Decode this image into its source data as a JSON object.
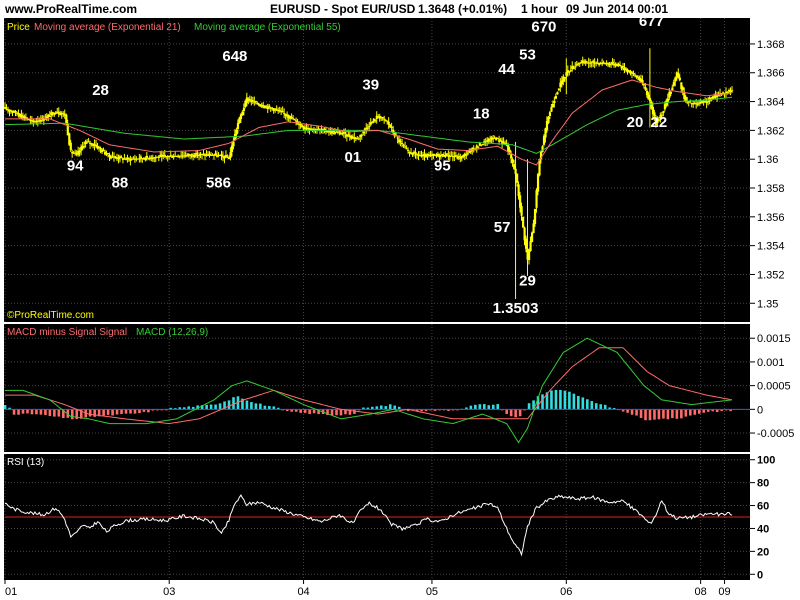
{
  "header": {
    "site": "www.ProRealTime.com",
    "instrument": "EURUSD - Spot EUR/USD",
    "price": "1.3648 (+0.01%)",
    "interval": "1 hour",
    "datetime": "09 Jun 2014 00:01"
  },
  "copyright": "©ProRealTime.com",
  "colors": {
    "background": "#000000",
    "price": "#ffff00",
    "ema21": "#ff6b6b",
    "ema55": "#33cc33",
    "macd_line": "#33cc33",
    "signal_line": "#ff6b6b",
    "hist_pos": "#33dddd",
    "hist_neg": "#ff6b6b",
    "rsi_line": "#ffffff",
    "rsi_level": "#dd2222",
    "grid": "#444444",
    "annotation": "#ffffff"
  },
  "chart_data": [
    {
      "type": "candlestick",
      "legend": {
        "price": "Price",
        "ema21": "Moving average (Exponential 21)",
        "ema55": "Moving average (Exponential 55)"
      },
      "x_ticks": [
        "01",
        "03",
        "04",
        "05",
        "06",
        "08",
        "09"
      ],
      "y_ticks": [
        "1.368",
        "1.366",
        "1.364",
        "1.362",
        "1.36",
        "1.358",
        "1.356",
        "1.354",
        "1.352",
        "1.35"
      ],
      "y_tick_values": [
        1.368,
        1.366,
        1.364,
        1.362,
        1.36,
        1.358,
        1.356,
        1.354,
        1.352,
        1.35
      ],
      "ylim": [
        1.3487,
        1.3698
      ],
      "grid": true,
      "price_waypoints": [
        [
          0,
          1.3635
        ],
        [
          8,
          1.3632
        ],
        [
          18,
          1.3626
        ],
        [
          26,
          1.3628
        ],
        [
          34,
          1.3633
        ],
        [
          40,
          1.3631
        ],
        [
          44,
          1.3605
        ],
        [
          48,
          1.3603
        ],
        [
          54,
          1.3612
        ],
        [
          60,
          1.361
        ],
        [
          70,
          1.3602
        ],
        [
          82,
          1.36
        ],
        [
          95,
          1.3601
        ],
        [
          108,
          1.3602
        ],
        [
          125,
          1.3603
        ],
        [
          140,
          1.3603
        ],
        [
          150,
          1.3601
        ],
        [
          156,
          1.3625
        ],
        [
          162,
          1.3642
        ],
        [
          170,
          1.3638
        ],
        [
          180,
          1.3635
        ],
        [
          190,
          1.363
        ],
        [
          200,
          1.3622
        ],
        [
          212,
          1.362
        ],
        [
          226,
          1.3618
        ],
        [
          236,
          1.3614
        ],
        [
          242,
          1.3622
        ],
        [
          250,
          1.363
        ],
        [
          256,
          1.3626
        ],
        [
          262,
          1.3615
        ],
        [
          270,
          1.3605
        ],
        [
          280,
          1.3602
        ],
        [
          295,
          1.3603
        ],
        [
          305,
          1.3601
        ],
        [
          318,
          1.361
        ],
        [
          328,
          1.3615
        ],
        [
          336,
          1.361
        ],
        [
          342,
          1.359
        ],
        [
          346,
          1.356
        ],
        [
          350,
          1.353
        ],
        [
          354,
          1.3555
        ],
        [
          358,
          1.36
        ],
        [
          364,
          1.363
        ],
        [
          370,
          1.3648
        ],
        [
          376,
          1.366
        ],
        [
          384,
          1.3667
        ],
        [
          396,
          1.3667
        ],
        [
          410,
          1.3666
        ],
        [
          418,
          1.3661
        ],
        [
          426,
          1.3655
        ],
        [
          432,
          1.364
        ],
        [
          436,
          1.3625
        ],
        [
          440,
          1.3632
        ],
        [
          446,
          1.3648
        ],
        [
          450,
          1.366
        ],
        [
          456,
          1.364
        ],
        [
          462,
          1.3638
        ],
        [
          470,
          1.364
        ],
        [
          478,
          1.3645
        ],
        [
          487,
          1.3648
        ]
      ],
      "ema21_waypoints": [
        [
          0,
          1.3628
        ],
        [
          30,
          1.3628
        ],
        [
          50,
          1.362
        ],
        [
          70,
          1.361
        ],
        [
          100,
          1.3605
        ],
        [
          130,
          1.3606
        ],
        [
          150,
          1.3611
        ],
        [
          170,
          1.3622
        ],
        [
          190,
          1.3626
        ],
        [
          210,
          1.3623
        ],
        [
          230,
          1.3619
        ],
        [
          250,
          1.362
        ],
        [
          270,
          1.3614
        ],
        [
          290,
          1.3607
        ],
        [
          310,
          1.3606
        ],
        [
          330,
          1.3609
        ],
        [
          346,
          1.36
        ],
        [
          356,
          1.3596
        ],
        [
          366,
          1.3612
        ],
        [
          380,
          1.3632
        ],
        [
          400,
          1.3648
        ],
        [
          420,
          1.3655
        ],
        [
          436,
          1.365
        ],
        [
          450,
          1.3647
        ],
        [
          470,
          1.3644
        ],
        [
          487,
          1.3646
        ]
      ],
      "ema55_waypoints": [
        [
          0,
          1.3624
        ],
        [
          40,
          1.3625
        ],
        [
          80,
          1.3618
        ],
        [
          120,
          1.3614
        ],
        [
          160,
          1.3616
        ],
        [
          190,
          1.362
        ],
        [
          220,
          1.362
        ],
        [
          250,
          1.362
        ],
        [
          280,
          1.3616
        ],
        [
          310,
          1.3612
        ],
        [
          340,
          1.361
        ],
        [
          356,
          1.3604
        ],
        [
          370,
          1.3612
        ],
        [
          390,
          1.3624
        ],
        [
          410,
          1.3634
        ],
        [
          430,
          1.3638
        ],
        [
          450,
          1.364
        ],
        [
          470,
          1.3641
        ],
        [
          487,
          1.3643
        ]
      ],
      "annotations": [
        {
          "text": "28",
          "x": 64,
          "y": 1.36445
        },
        {
          "text": "94",
          "x": 47,
          "y": 1.35923
        },
        {
          "text": "88",
          "x": 77,
          "y": 1.35803
        },
        {
          "text": "648",
          "x": 154,
          "y": 1.36683
        },
        {
          "text": "586",
          "x": 143,
          "y": 1.35803
        },
        {
          "text": "39",
          "x": 245,
          "y": 1.36482
        },
        {
          "text": "01",
          "x": 233,
          "y": 1.35982
        },
        {
          "text": "18",
          "x": 319,
          "y": 1.36283
        },
        {
          "text": "95",
          "x": 293,
          "y": 1.35923
        },
        {
          "text": "44",
          "x": 336,
          "y": 1.36591
        },
        {
          "text": "53",
          "x": 350,
          "y": 1.36693
        },
        {
          "text": "670",
          "x": 361,
          "y": 1.36888
        },
        {
          "text": "677",
          "x": 433,
          "y": 1.36923
        },
        {
          "text": "20",
          "x": 422,
          "y": 1.36223
        },
        {
          "text": "22",
          "x": 438,
          "y": 1.36223
        },
        {
          "text": "57",
          "x": 333,
          "y": 1.35493
        },
        {
          "text": "29",
          "x": 350,
          "y": 1.35122
        },
        {
          "text": "1.3503",
          "x": 342,
          "y": 1.34931
        }
      ]
    },
    {
      "type": "bar",
      "legend": {
        "hist": "MACD minus Signal Signal",
        "macd": "MACD (12,26,9)"
      },
      "y_ticks": [
        "0.0015",
        "0.001",
        "0.0005",
        "0",
        "-0.0005"
      ],
      "y_tick_values": [
        0.0015,
        0.001,
        0.0005,
        0,
        -0.0005
      ],
      "ylim": [
        -0.0009,
        0.0018
      ],
      "histogram_waypoints": [
        [
          0,
          9e-05
        ],
        [
          5,
          2e-05
        ],
        [
          6,
          -0.0001
        ],
        [
          20,
          -0.0001
        ],
        [
          44,
          -0.0002
        ],
        [
          50,
          -0.0002
        ],
        [
          60,
          -0.00015
        ],
        [
          90,
          -8e-05
        ],
        [
          110,
          2e-05
        ],
        [
          140,
          0.0001
        ],
        [
          150,
          0.0002
        ],
        [
          155,
          0.0003
        ],
        [
          165,
          0.00015
        ],
        [
          180,
          5e-05
        ],
        [
          190,
          -5e-05
        ],
        [
          200,
          -8e-05
        ],
        [
          220,
          -0.00012
        ],
        [
          234,
          -0.0001
        ],
        [
          240,
          3e-05
        ],
        [
          260,
          0.0001
        ],
        [
          270,
          -3e-05
        ],
        [
          300,
          -2e-05
        ],
        [
          316,
          0.0001
        ],
        [
          330,
          0.0001
        ],
        [
          336,
          -0.0001
        ],
        [
          344,
          -0.0002
        ],
        [
          350,
          0.0001
        ],
        [
          358,
          0.0003
        ],
        [
          366,
          0.0004
        ],
        [
          375,
          0.0004
        ],
        [
          390,
          0.0002
        ],
        [
          410,
          0.0
        ],
        [
          420,
          -0.0001
        ],
        [
          430,
          -0.00025
        ],
        [
          436,
          -0.0002
        ],
        [
          450,
          -0.0002
        ],
        [
          470,
          -5e-05
        ],
        [
          487,
          -3e-05
        ]
      ],
      "macd_waypoints": [
        [
          0,
          0.0004
        ],
        [
          12,
          0.0004
        ],
        [
          30,
          0.0002
        ],
        [
          44,
          -0.00015
        ],
        [
          56,
          -0.0002
        ],
        [
          70,
          -0.0003
        ],
        [
          95,
          -0.0003
        ],
        [
          115,
          -0.0002
        ],
        [
          140,
          0.0002
        ],
        [
          152,
          0.0005
        ],
        [
          162,
          0.0006
        ],
        [
          180,
          0.0004
        ],
        [
          200,
          0.0001
        ],
        [
          225,
          -0.0002
        ],
        [
          245,
          -0.0001
        ],
        [
          260,
          0.0
        ],
        [
          280,
          -0.0002
        ],
        [
          300,
          -0.0003
        ],
        [
          320,
          -0.0001
        ],
        [
          336,
          -0.0003
        ],
        [
          344,
          -0.0007
        ],
        [
          350,
          -0.0004
        ],
        [
          360,
          0.0005
        ],
        [
          374,
          0.0012
        ],
        [
          390,
          0.0015
        ],
        [
          410,
          0.0012
        ],
        [
          428,
          0.0005
        ],
        [
          440,
          0.0002
        ],
        [
          460,
          0.0001
        ],
        [
          487,
          0.0002
        ]
      ],
      "signal_waypoints": [
        [
          0,
          0.0003
        ],
        [
          20,
          0.0003
        ],
        [
          40,
          0.0001
        ],
        [
          56,
          -0.0001
        ],
        [
          80,
          -0.0002
        ],
        [
          110,
          -0.0003
        ],
        [
          130,
          -0.0002
        ],
        [
          160,
          0.0002
        ],
        [
          180,
          0.0004
        ],
        [
          200,
          0.0002
        ],
        [
          225,
          0.0
        ],
        [
          250,
          -0.0001
        ],
        [
          270,
          0.0
        ],
        [
          300,
          -0.0002
        ],
        [
          330,
          -0.0002
        ],
        [
          350,
          -0.0002
        ],
        [
          365,
          0.0004
        ],
        [
          380,
          0.0009
        ],
        [
          398,
          0.0013
        ],
        [
          414,
          0.0013
        ],
        [
          430,
          0.0008
        ],
        [
          445,
          0.0005
        ],
        [
          470,
          0.0003
        ],
        [
          487,
          0.0002
        ]
      ]
    },
    {
      "type": "line",
      "legend": {
        "rsi": "RSI (13)"
      },
      "y_ticks": [
        "100",
        "80",
        "60",
        "40",
        "20",
        "0"
      ],
      "y_tick_values": [
        100,
        80,
        60,
        40,
        20,
        0
      ],
      "ylim": [
        -5,
        105
      ],
      "level": 50,
      "rsi_waypoints": [
        [
          0,
          62
        ],
        [
          6,
          57
        ],
        [
          12,
          55
        ],
        [
          20,
          53
        ],
        [
          26,
          52
        ],
        [
          34,
          58
        ],
        [
          38,
          52
        ],
        [
          40,
          48
        ],
        [
          44,
          33
        ],
        [
          48,
          36
        ],
        [
          52,
          43
        ],
        [
          56,
          40
        ],
        [
          62,
          46
        ],
        [
          68,
          37
        ],
        [
          74,
          43
        ],
        [
          82,
          47
        ],
        [
          95,
          48
        ],
        [
          108,
          47
        ],
        [
          120,
          51
        ],
        [
          132,
          48
        ],
        [
          140,
          45
        ],
        [
          145,
          35
        ],
        [
          150,
          47
        ],
        [
          154,
          62
        ],
        [
          158,
          68
        ],
        [
          162,
          61
        ],
        [
          170,
          63
        ],
        [
          180,
          58
        ],
        [
          190,
          54
        ],
        [
          200,
          50
        ],
        [
          212,
          46
        ],
        [
          224,
          52
        ],
        [
          233,
          44
        ],
        [
          238,
          55
        ],
        [
          244,
          62
        ],
        [
          252,
          56
        ],
        [
          258,
          44
        ],
        [
          266,
          40
        ],
        [
          274,
          42
        ],
        [
          282,
          48
        ],
        [
          292,
          46
        ],
        [
          300,
          52
        ],
        [
          310,
          56
        ],
        [
          318,
          59
        ],
        [
          324,
          62
        ],
        [
          330,
          58
        ],
        [
          336,
          40
        ],
        [
          341,
          27
        ],
        [
          346,
          18
        ],
        [
          350,
          42
        ],
        [
          356,
          58
        ],
        [
          364,
          65
        ],
        [
          372,
          68
        ],
        [
          382,
          66
        ],
        [
          394,
          67
        ],
        [
          404,
          63
        ],
        [
          414,
          64
        ],
        [
          420,
          58
        ],
        [
          426,
          52
        ],
        [
          432,
          44
        ],
        [
          436,
          52
        ],
        [
          440,
          65
        ],
        [
          444,
          54
        ],
        [
          450,
          49
        ],
        [
          460,
          50
        ],
        [
          472,
          53
        ],
        [
          480,
          52
        ],
        [
          487,
          53
        ]
      ]
    }
  ]
}
